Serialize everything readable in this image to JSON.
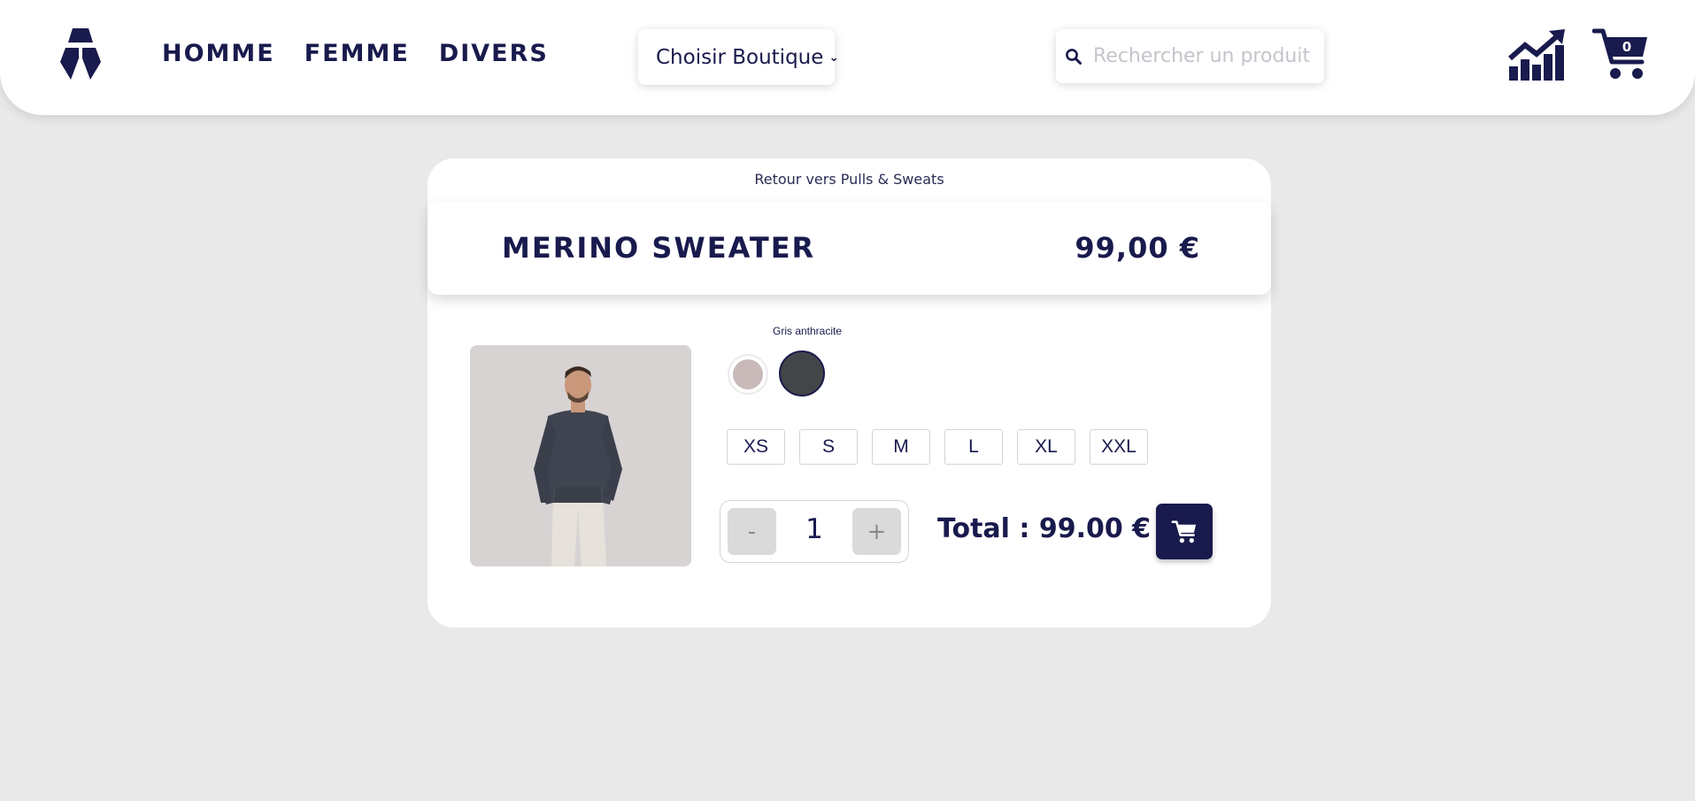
{
  "header": {
    "nav": [
      "HOMME",
      "FEMME",
      "DIVERS"
    ],
    "shop_select": {
      "selected": "Choisir Boutique"
    },
    "search": {
      "placeholder": "Rechercher un produit",
      "value": ""
    },
    "cart_count": "0",
    "icons": [
      "brand-logo-icon",
      "search-icon",
      "stats-chart-icon",
      "cart-icon",
      "chevron-down-icon"
    ]
  },
  "product": {
    "back_link": "Retour vers Pulls & Sweats",
    "name": "MERINO SWEATER",
    "price": "99,00 €",
    "colors": [
      {
        "label": "",
        "hex": "#c9b9b9"
      },
      {
        "label": "Gris anthracite",
        "hex": "#444548"
      }
    ],
    "sizes": [
      "XS",
      "S",
      "M",
      "L",
      "XL",
      "XXL"
    ],
    "quantity": {
      "minus": "-",
      "value": "1",
      "plus": "+"
    },
    "total": "Total : 99.00 €"
  },
  "colors": {
    "primary": "#191a4d",
    "background": "#e9e9e9",
    "card": "#ffffff"
  }
}
